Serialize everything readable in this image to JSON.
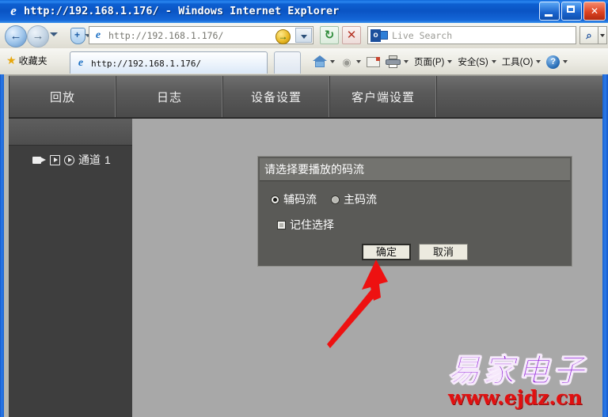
{
  "window": {
    "title": "http://192.168.1.176/ - Windows Internet Explorer",
    "app_icon": "internet-explorer-icon",
    "minimize_label": "",
    "maximize_label": "",
    "close_label": "✕"
  },
  "navbar": {
    "back_glyph": "←",
    "forward_glyph": "→",
    "address_value": "http://192.168.1.176/",
    "go_glyph": "→",
    "refresh_glyph": "↻",
    "stop_glyph": "✕",
    "search_placeholder": "Live Search",
    "search_icon_letter": "o",
    "search_go_glyph": "⌕"
  },
  "tabrow": {
    "favorites_label": "收藏夹",
    "star_glyph": "★",
    "tab_label": "http://192.168.1.176/",
    "commands": [
      {
        "label": "",
        "icon": "home-icon",
        "has_caret": true
      },
      {
        "label": "",
        "icon": "rss-icon",
        "has_caret": true
      },
      {
        "label": "",
        "icon": "mail-icon",
        "has_caret": false
      },
      {
        "label": "",
        "icon": "print-icon",
        "has_caret": true
      },
      {
        "label": "页面(P)",
        "icon": "",
        "has_caret": true
      },
      {
        "label": "安全(S)",
        "icon": "",
        "has_caret": true
      },
      {
        "label": "工具(O)",
        "icon": "",
        "has_caret": true
      },
      {
        "label": "",
        "icon": "help-icon",
        "has_caret": true
      }
    ],
    "rss_glyph": "◉"
  },
  "app_nav": {
    "tabs": [
      {
        "label": "回放"
      },
      {
        "label": "日志"
      },
      {
        "label": "设备设置"
      },
      {
        "label": "客户端设置"
      }
    ]
  },
  "sidebar": {
    "channel_label": "通道",
    "channel_number": "1",
    "icons": [
      "video-camera-icon",
      "play-square-icon",
      "play-circle-icon"
    ]
  },
  "dialog": {
    "title": "请选择要播放的码流",
    "radio_options": [
      {
        "label": "辅码流",
        "selected": true
      },
      {
        "label": "主码流",
        "selected": false
      }
    ],
    "checkbox_label": "记住选择",
    "checkbox_checked": false,
    "ok_label": "确定",
    "cancel_label": "取消"
  },
  "annotation": {
    "arrow_color": "#ee1111",
    "arrow_points_to": "确定"
  },
  "watermark": {
    "brand": "易家电子",
    "url": "www.ejdz.cn",
    "brand_color": "#8f1fd8",
    "url_color": "#e01010"
  },
  "colors": {
    "titlebar_blue": "#0a54c4",
    "app_nav_gray": "#5a5a5a",
    "sidebar_dark": "#3e3e3e",
    "content_gray": "#a8a8a8",
    "dialog_gray": "#5a5a57",
    "dialog_header_gray": "#73736f"
  }
}
